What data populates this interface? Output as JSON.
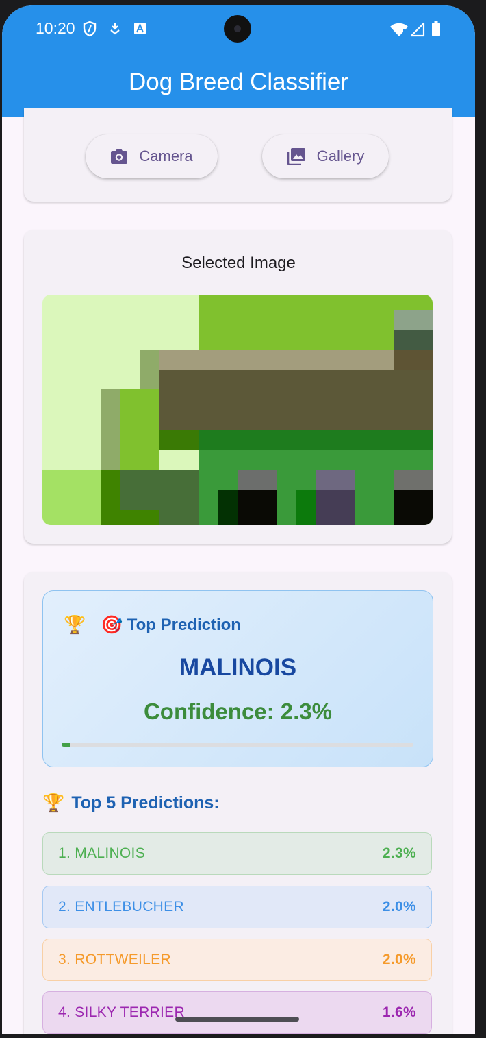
{
  "status_bar": {
    "time": "10:20",
    "left_icons": [
      "shield-icon",
      "download-icon",
      "a-badge-icon"
    ],
    "right_icons": [
      "wifi-icon",
      "signal-icon",
      "battery-icon"
    ]
  },
  "app_bar": {
    "title": "Dog Breed Classifier",
    "color": "#2690ea"
  },
  "source_buttons": {
    "camera_label": "Camera",
    "gallery_label": "Gallery"
  },
  "selected_image": {
    "title": "Selected Image"
  },
  "top_prediction": {
    "heading_icon_1": "🏆",
    "heading_icon_2": "🎯",
    "label": "Top Prediction",
    "breed": "MALINOIS",
    "confidence_text": "Confidence: 2.3%",
    "confidence_value": 0.023
  },
  "top5": {
    "title_icon": "🏆",
    "title": "Top 5 Predictions:",
    "items": [
      {
        "label": "1. MALINOIS",
        "value": "2.3%",
        "color": "#4caf50",
        "bg": "#e3ebe6",
        "border": "#b9d9bb"
      },
      {
        "label": "2. ENTLEBUCHER",
        "value": "2.0%",
        "color": "#3d8fe6",
        "bg": "#e1e8f8",
        "border": "#a6c9f2"
      },
      {
        "label": "3. ROTTWEILER",
        "value": "2.0%",
        "color": "#f59a2b",
        "bg": "#fbece3",
        "border": "#f8d0a6"
      },
      {
        "label": "4. SILKY TERRIER",
        "value": "1.6%",
        "color": "#9c27b0",
        "bg": "#ecd9f0",
        "border": "#d6b0e0"
      }
    ]
  }
}
